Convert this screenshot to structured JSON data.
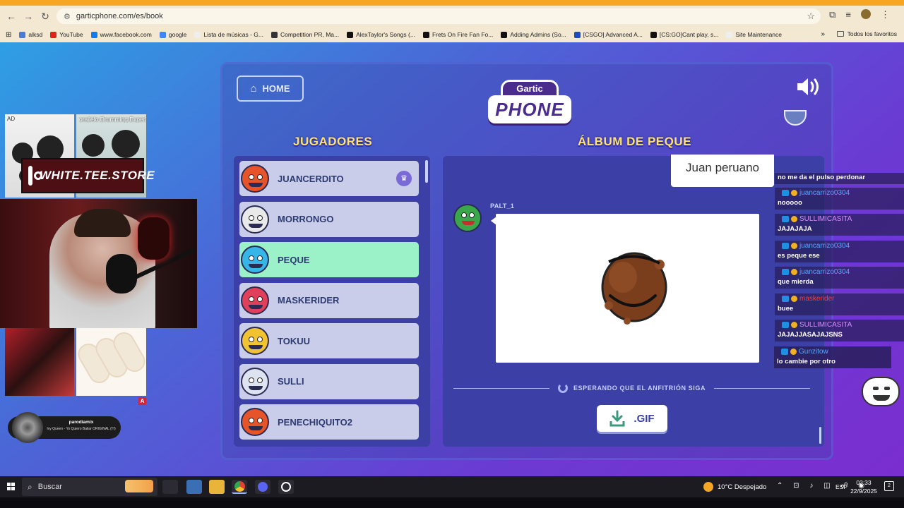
{
  "browser": {
    "url": "garticphone.com/es/book",
    "bookmarks": [
      {
        "label": "alksd",
        "icon": "globe-icon",
        "color": "#4c7cd1"
      },
      {
        "label": "YouTube",
        "icon": "youtube-icon",
        "color": "#e62117"
      },
      {
        "label": "www.facebook.com",
        "icon": "facebook-icon",
        "color": "#1877f2"
      },
      {
        "label": "google",
        "icon": "google-icon",
        "color": "#4285f4"
      },
      {
        "label": "Lista de músicas - G...",
        "icon": "page-icon",
        "color": "#eeeeee"
      },
      {
        "label": "Competition PR, Ma...",
        "icon": "compass-icon",
        "color": "#333333"
      },
      {
        "label": "AlexTaylor's Songs (...",
        "icon": "github-icon",
        "color": "#111111"
      },
      {
        "label": "Frets On Fire Fan Fo...",
        "icon": "github-icon",
        "color": "#111111"
      },
      {
        "label": "Adding Admins (So...",
        "icon": "github-icon",
        "color": "#111111"
      },
      {
        "label": "[CSGO] Advanced A...",
        "icon": "site-icon",
        "color": "#1e4db7"
      },
      {
        "label": "[CS:GO]Cant play, s...",
        "icon": "github-icon",
        "color": "#111111"
      },
      {
        "label": "Site Maintenance",
        "icon": "page-icon",
        "color": "#eeeeee"
      }
    ],
    "all_bookmarks": "Todos los favoritos"
  },
  "game": {
    "home_label": "HOME",
    "logo_top": "Gartic",
    "logo_bottom": "PHONE",
    "players_heading": "JUGADORES",
    "album_heading": "ÁLBUM DE PEQUE",
    "players": [
      {
        "name": "JUANCERDITO",
        "color": "#e8542a",
        "host": true,
        "active": false
      },
      {
        "name": "MORRONGO",
        "color": "#e9e9e9",
        "host": false,
        "active": false
      },
      {
        "name": "PEQUE",
        "color": "#36b5e8",
        "host": false,
        "active": true
      },
      {
        "name": "MASKERIDER",
        "color": "#e2405a",
        "host": false,
        "active": false
      },
      {
        "name": "TOKUU",
        "color": "#f1c232",
        "host": false,
        "active": false
      },
      {
        "name": "SULLI",
        "color": "#dde3f0",
        "host": false,
        "active": false
      },
      {
        "name": "PENECHIQUITO2",
        "color": "#e8542a",
        "host": false,
        "active": false
      }
    ],
    "album": {
      "previous_text": "Juan peruano",
      "author": "PALT_1",
      "waiting": "ESPERANDO QUE EL ANFITRIÓN SIGA",
      "gif_label": ".GIF"
    }
  },
  "chat": {
    "top_text": "no me da el pulso perdonar",
    "messages": [
      {
        "user": "juancarrizo0304",
        "user_color": "#5aa7ff",
        "text": "nooooo"
      },
      {
        "user": "SULLIMICASITA",
        "user_color": "#d98cff",
        "text": "JAJAJAJA"
      },
      {
        "user": "juancarrizo0304",
        "user_color": "#5aa7ff",
        "text": "es peque ese"
      },
      {
        "user": "juancarrizo0304",
        "user_color": "#5aa7ff",
        "text": "que mierda"
      },
      {
        "user": "maskerider",
        "user_color": "#ff3b3b",
        "text": "buee"
      },
      {
        "user": "SULLIMICASITA",
        "user_color": "#d98cff",
        "text": "JAJAJJASAJAJSNS"
      },
      {
        "user": "Gunzitow",
        "user_color": "#5aa7ff",
        "text": "lo cambie por otro"
      }
    ]
  },
  "overlay": {
    "ad_label": "AD",
    "ad2_label": "orailelo Drumming Experi",
    "instagram": "WHITE.TEE.STORE",
    "ad_badge": "A",
    "music_title": "parodiamix",
    "music_sub": "Ivy Queen - Yo Quiero Bailar ORIGINAL (!!!)"
  },
  "taskbar": {
    "search": "Buscar",
    "weather": "10°C  Despejado",
    "lang": "ESP",
    "time": "02:33",
    "date": "22/9/2025",
    "notif": "2"
  }
}
